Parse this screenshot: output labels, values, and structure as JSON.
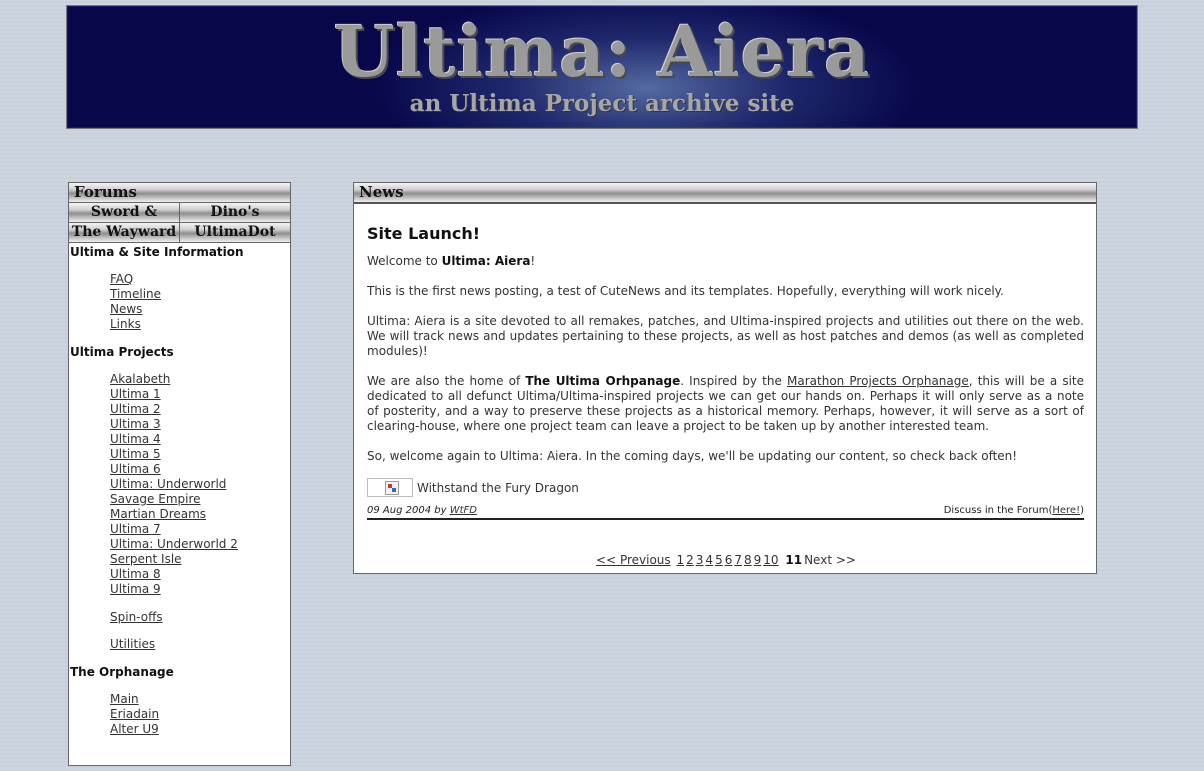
{
  "banner": {
    "title": "Ultima: Aiera",
    "subtitle": "an Ultima Project archive site"
  },
  "sidebar": {
    "forums_header": "Forums",
    "forum_links": [
      [
        "Sword & Shield",
        "Dino's Forums"
      ],
      [
        "The Wayward",
        "UltimaDot"
      ]
    ],
    "site_info": {
      "heading": "Ultima & Site Information",
      "links": [
        "FAQ",
        "Timeline",
        "News",
        "Links"
      ]
    },
    "projects": {
      "heading": "Ultima Projects",
      "links": [
        "Akalabeth",
        "Ultima 1",
        "Ultima 2",
        "Ultima 3",
        "Ultima 4",
        "Ultima 5",
        "Ultima 6",
        "Ultima: Underworld",
        "Savage Empire",
        "Martian Dreams",
        "Ultima 7",
        "Ultima: Underworld 2",
        "Serpent Isle",
        "Ultima 8",
        "Ultima 9"
      ],
      "spinoffs": "Spin-offs",
      "utilities": "Utilities"
    },
    "orphanage": {
      "heading": "The Orphanage",
      "links": [
        "Main",
        "Eriadain",
        "Alter U9"
      ]
    }
  },
  "news": {
    "header": "News",
    "article": {
      "title": "Site Launch!",
      "welcome_prefix": "Welcome to ",
      "welcome_bold": "Ultima: Aiera",
      "welcome_suffix": "!",
      "para1": "This is the first news posting, a test of CuteNews and its templates. Hopefully, everything will work nicely.",
      "para2": "Ultima: Aiera is a site devoted to all remakes, patches, and Ultima-inspired projects and utilities out there on the web. We will track news and updates pertaining to these projects, as well as host patches and demos (as well as completed modules)!",
      "para3_a": "We are also the home of ",
      "para3_bold": "The Ultima Orhpanage",
      "para3_b": ". Inspired by the ",
      "para3_link": "Marathon Projects Orphanage",
      "para3_c": ", this will be a site dedicated to all defunct Ultima/Ultima-inspired projects we can get our hands on. Perhaps it will only serve as a note of posterity, and a way to preserve these projects as a historical memory. Perhaps, however, it will serve as a sort of clearing-house, where one project team can leave a project to be taken up by another interested team.",
      "para4": "So, welcome again to Ultima: Aiera. In the coming days, we'll be updating our content, so check back often!",
      "signature": "Withstand the Fury Dragon",
      "date_prefix": "09 Aug 2004 by ",
      "author": "WtFD",
      "discuss_prefix": "Discuss in the Forum(",
      "discuss_link": "Here!",
      "discuss_suffix": ")"
    },
    "pager": {
      "previous": "<< Previous",
      "pages": [
        "1",
        "2",
        "3",
        "4",
        "5",
        "6",
        "7",
        "8",
        "9",
        "10"
      ],
      "current": "11",
      "next": "Next >>"
    }
  }
}
